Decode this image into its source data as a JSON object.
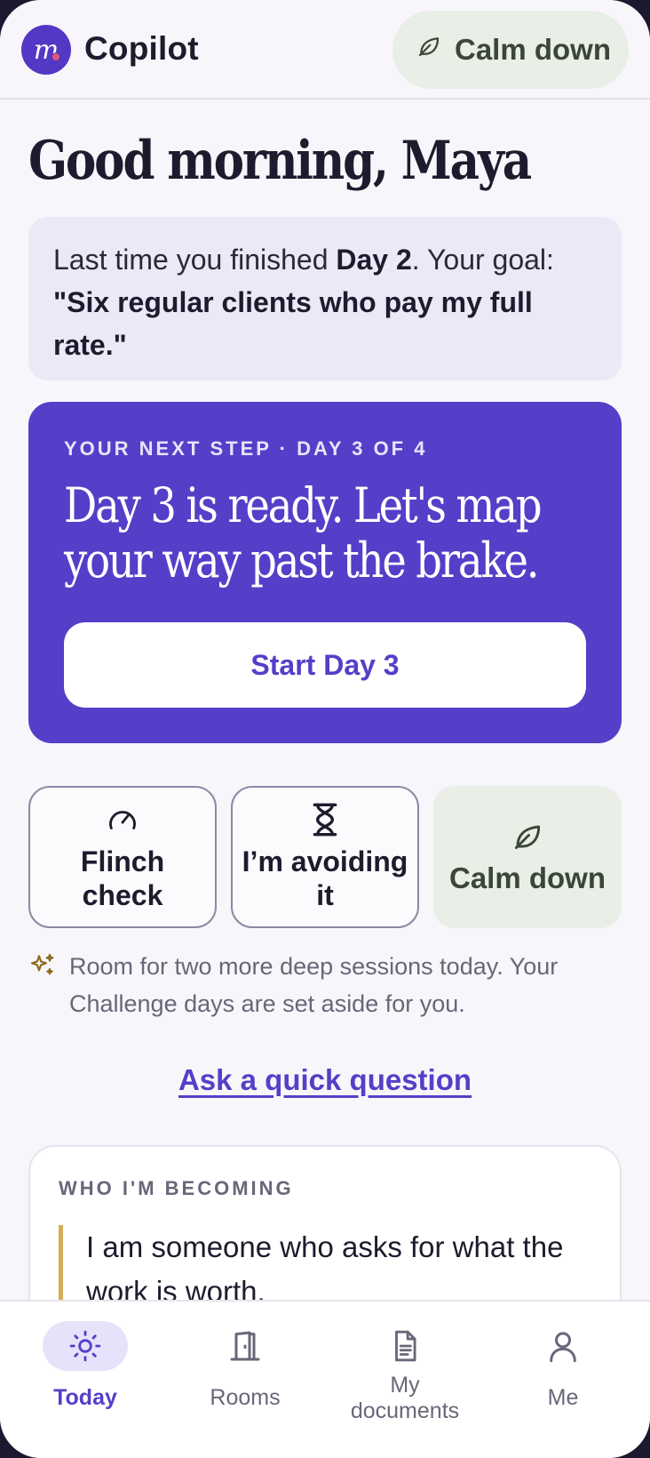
{
  "header": {
    "logo_letter": "m",
    "app_title": "Copilot",
    "calm_button_label": "Calm down"
  },
  "greeting": "Good morning, Maya",
  "recap": {
    "prefix": "Last time you finished ",
    "day": "Day 2",
    "middle": ". Your goal: ",
    "goal": "\"Six regular clients who pay my full rate.\""
  },
  "next_step": {
    "eyebrow": "YOUR NEXT STEP · DAY 3 OF 4",
    "title": "Day 3 is ready. Let's map your way past the brake.",
    "button_label": "Start Day 3"
  },
  "actions": [
    {
      "label": "Flinch check",
      "icon": "gauge-icon"
    },
    {
      "label": "I’m avoiding it",
      "icon": "hourglass-icon"
    },
    {
      "label": "Calm down",
      "icon": "leaf-icon"
    }
  ],
  "note": "Room for two more deep sessions today. Your Challenge days are set aside for you.",
  "ask_link": "Ask a quick question",
  "identity": {
    "eyebrow": "WHO I'M BECOMING",
    "quote": "I am someone who asks for what the work is worth."
  },
  "nav": [
    {
      "label": "Today",
      "icon": "sun-icon",
      "active": true
    },
    {
      "label": "Rooms",
      "icon": "door-icon",
      "active": false
    },
    {
      "label": "My documents",
      "icon": "document-icon",
      "active": false
    },
    {
      "label": "Me",
      "icon": "person-icon",
      "active": false
    }
  ],
  "colors": {
    "primary": "#563ec8",
    "calm_bg": "#e9eee6",
    "accent_gold": "#d4ae58",
    "background": "#f8f6fb"
  }
}
